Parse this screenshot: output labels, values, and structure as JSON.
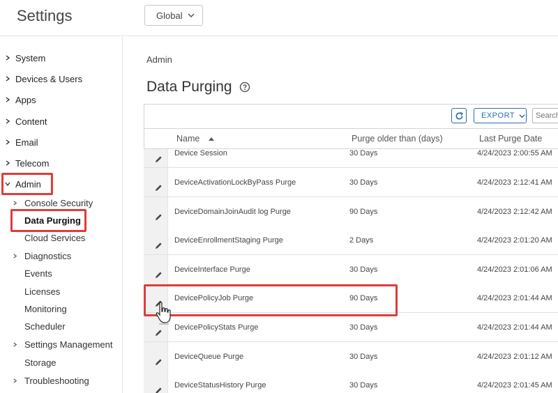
{
  "header": {
    "app_title": "Settings",
    "org_selector": "Global"
  },
  "sidebar": {
    "items": [
      {
        "label": "System"
      },
      {
        "label": "Devices & Users"
      },
      {
        "label": "Apps"
      },
      {
        "label": "Content"
      },
      {
        "label": "Email"
      },
      {
        "label": "Telecom"
      },
      {
        "label": "Admin",
        "expanded": true
      }
    ],
    "admin_children": [
      {
        "label": "Console Security",
        "has_children": true
      },
      {
        "label": "Data Purging",
        "active": true
      },
      {
        "label": "Cloud Services"
      },
      {
        "label": "Diagnostics",
        "has_children": true
      },
      {
        "label": "Events"
      },
      {
        "label": "Licenses"
      },
      {
        "label": "Monitoring"
      },
      {
        "label": "Scheduler"
      },
      {
        "label": "Settings Management",
        "has_children": true
      },
      {
        "label": "Storage"
      },
      {
        "label": "Troubleshooting",
        "has_children": true
      }
    ]
  },
  "main": {
    "breadcrumb": "Admin",
    "title": "Data Purging",
    "toolbar": {
      "export_label": "EXPORT",
      "search_placeholder": "Search"
    },
    "table": {
      "columns": [
        "Name",
        "Purge older than (days)",
        "Last Purge Date"
      ],
      "sort_column": "Name",
      "sort_direction": "ascending",
      "rows": [
        {
          "name": "Device Session",
          "days": "30 Days",
          "last": "4/24/2023 2:00:55 AM"
        },
        {
          "name": "DeviceActivationLockByPass Purge",
          "days": "30 Days",
          "last": "4/24/2023 2:12:41 AM"
        },
        {
          "name": "DeviceDomainJoinAudit log Purge",
          "days": "90 Days",
          "last": "4/24/2023 2:12:42 AM"
        },
        {
          "name": "DeviceEnrollmentStaging Purge",
          "days": "2 Days",
          "last": "4/24/2023 2:01:20 AM"
        },
        {
          "name": "DeviceInterface Purge",
          "days": "30 Days",
          "last": "4/24/2023 2:01:06 AM"
        },
        {
          "name": "DevicePolicyJob Purge",
          "days": "90 Days",
          "last": "4/24/2023 2:01:44 AM"
        },
        {
          "name": "DevicePolicyStats Purge",
          "days": "30 Days",
          "last": "4/24/2023 2:01:44 AM"
        },
        {
          "name": "DeviceQueue Purge",
          "days": "30 Days",
          "last": "4/24/2023 2:01:12 AM"
        },
        {
          "name": "DeviceStatusHistory Purge",
          "days": "30 Days",
          "last": "4/24/2023 2:01:45 AM"
        }
      ]
    }
  },
  "colors": {
    "highlight": "#e03b3b",
    "accent": "#2b6cb0"
  }
}
